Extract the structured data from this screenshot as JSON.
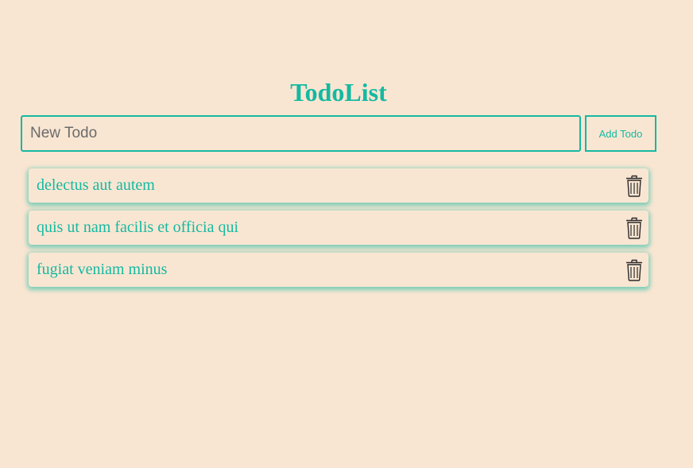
{
  "title": "TodoList",
  "input": {
    "placeholder": "New Todo",
    "value": ""
  },
  "add_button_label": "Add Todo",
  "todos": [
    {
      "text": "delectus aut autem",
      "icon": "trash-icon"
    },
    {
      "text": "quis ut nam facilis et officia qui",
      "icon": "trash-icon"
    },
    {
      "text": "fugiat veniam minus",
      "icon": "trash-icon"
    }
  ],
  "colors": {
    "background": "#f9e6d2",
    "accent": "#14b9a2"
  }
}
